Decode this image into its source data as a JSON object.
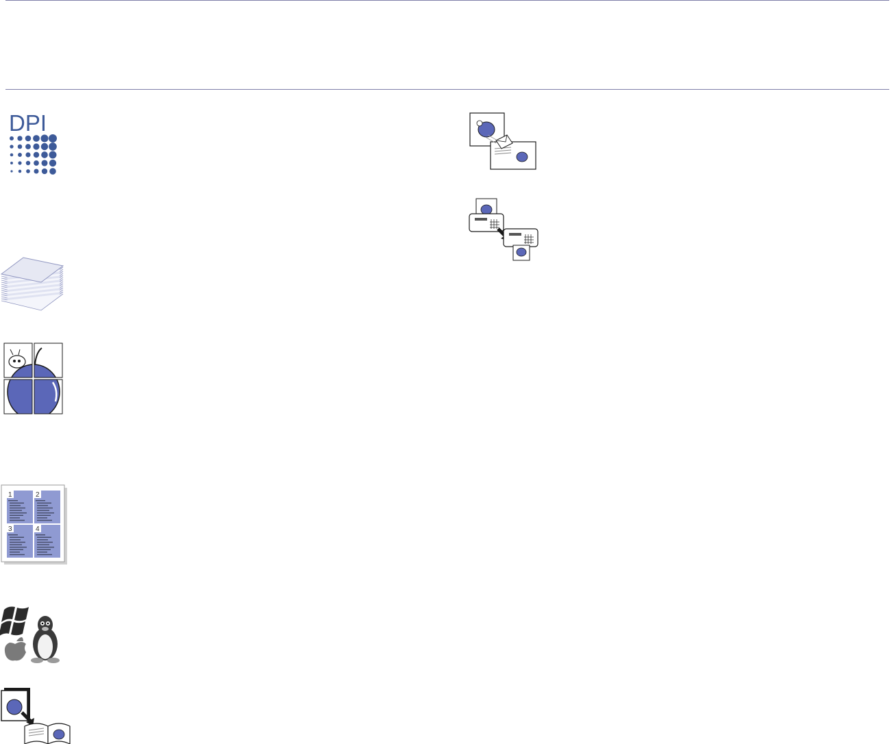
{
  "page": {
    "background": "#ffffff",
    "rule_color": "#7e7ea8",
    "accent": "#3d5a99",
    "apple_blue": "#5b67b8"
  },
  "dpi_badge": {
    "text": "DPI"
  },
  "nup_layout": {
    "pages": [
      "1",
      "2",
      "3",
      "4"
    ]
  },
  "icons": [
    "dpi-resolution-icon",
    "paper-stack-icon",
    "poster-print-icon",
    "n-up-print-icon",
    "os-compatibility-icon",
    "booklet-print-icon",
    "scan-to-email-icon",
    "fax-icon"
  ]
}
